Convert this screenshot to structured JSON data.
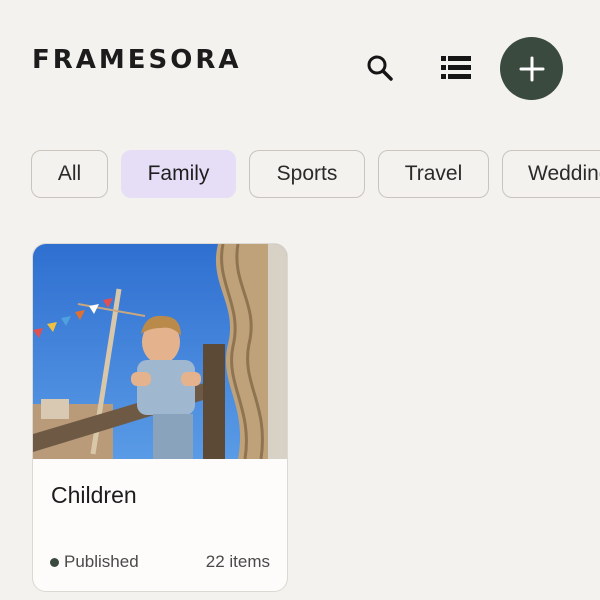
{
  "header": {
    "logo": "FRAMESORA",
    "search_icon": "search-icon",
    "list_icon": "list-view-icon",
    "add_icon": "plus-icon"
  },
  "filters": [
    {
      "label": "All",
      "active": false
    },
    {
      "label": "Family",
      "active": true
    },
    {
      "label": "Sports",
      "active": false
    },
    {
      "label": "Travel",
      "active": false
    },
    {
      "label": "Wedding",
      "active": false
    }
  ],
  "albums": [
    {
      "title": "Children",
      "status": "Published",
      "count": "22 items"
    }
  ],
  "colors": {
    "background": "#f4f2ee",
    "accent_dark": "#3b4a3f",
    "chip_active": "#e6def6",
    "chip_border": "#c9c4bd"
  }
}
